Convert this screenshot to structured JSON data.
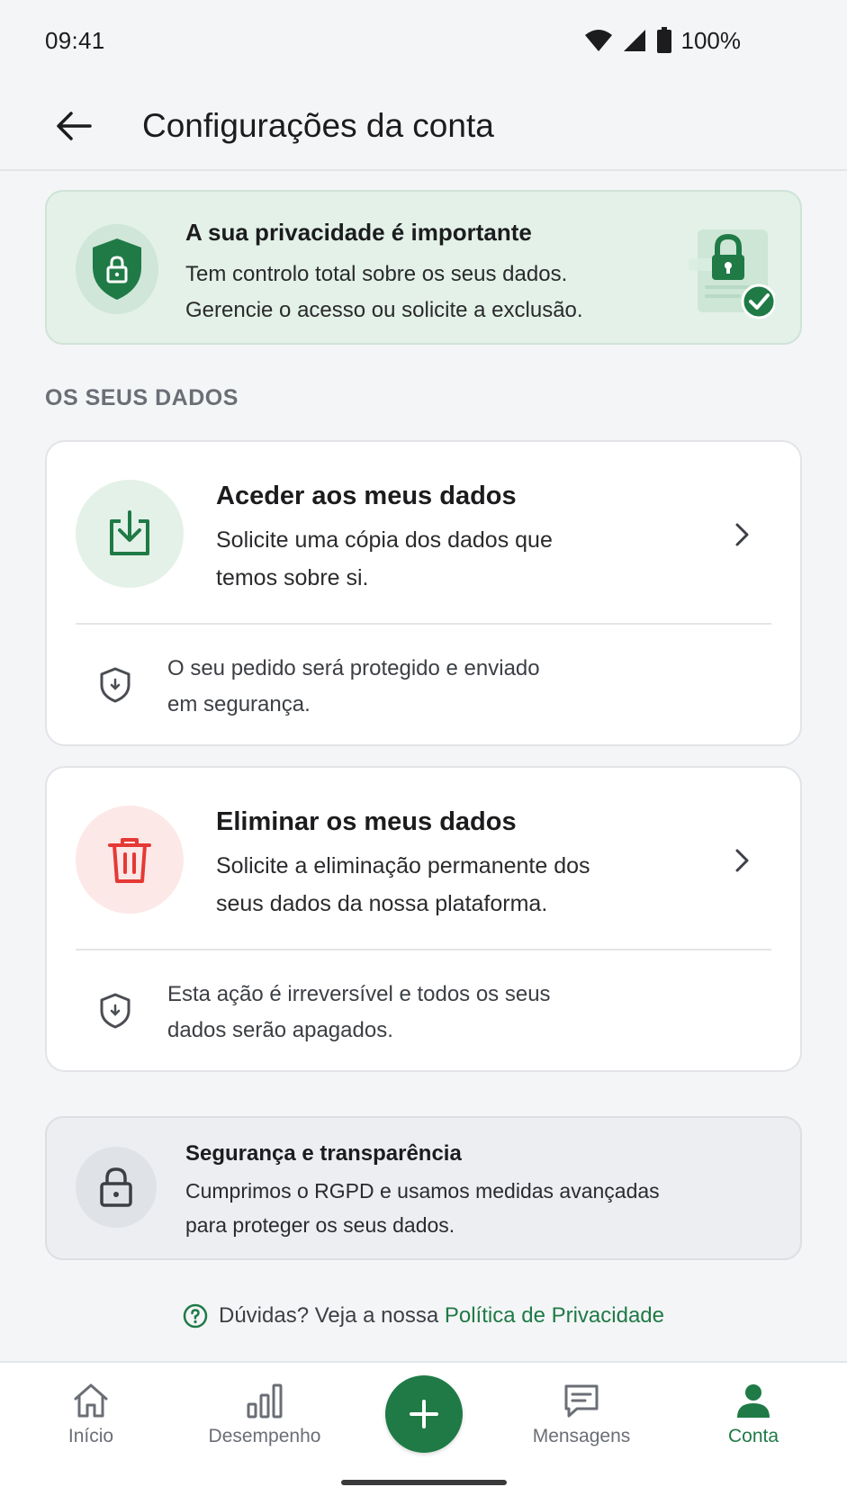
{
  "status_bar": {
    "time": "09:41",
    "battery": "100%",
    "icons": [
      "wifi-icon",
      "signal-icon",
      "battery-icon"
    ]
  },
  "app_bar": {
    "title": "Configurações da conta",
    "back_icon": "arrow-left-icon"
  },
  "privacy_banner": {
    "title": "A sua privacidade é importante",
    "line1": "Tem controlo total sobre os seus dados.",
    "line2": "Gerencie o acesso ou solicite a exclusão.",
    "icon": "shield-lock-icon",
    "illustration": "document-lock-check-icon"
  },
  "section": {
    "title": "OS SEUS DADOS"
  },
  "cards": [
    {
      "title": "Aceder aos meus dados",
      "desc_line1": "Solicite uma cópia dos dados que",
      "desc_line2": "temos sobre si.",
      "note_line1": "O seu pedido será protegido e enviado",
      "note_line2": "em segurança.",
      "icon": "download-icon",
      "accent": "#1f7a46"
    },
    {
      "title": "Eliminar os meus dados",
      "desc_line1": "Solicite a eliminação permanente dos",
      "desc_line2": "seus dados da nossa plataforma.",
      "note_line1": "Esta ação é irreversível e todos os seus",
      "note_line2": "dados serão apagados.",
      "icon": "trash-icon",
      "accent": "#e53935"
    }
  ],
  "security": {
    "title": "Segurança e transparência",
    "line1": "Cumprimos o RGPD e usamos medidas avançadas",
    "line2": "para proteger os seus dados.",
    "icon": "lock-icon"
  },
  "help": {
    "text": "Dúvidas? Veja a nossa",
    "link": "Política de Privacidade"
  },
  "bottom_nav": {
    "items": [
      {
        "label": "Início",
        "icon": "home-icon"
      },
      {
        "label": "Desempenho",
        "icon": "bar-chart-icon"
      },
      {
        "label": "Mensagens",
        "icon": "message-icon"
      },
      {
        "label": "Conta",
        "icon": "user-icon",
        "active": true
      }
    ],
    "fab_icon": "plus-icon"
  },
  "colors": {
    "brand_green": "#1f7a46",
    "danger_red": "#e53935",
    "banner_bg": "#e3f1e8"
  }
}
